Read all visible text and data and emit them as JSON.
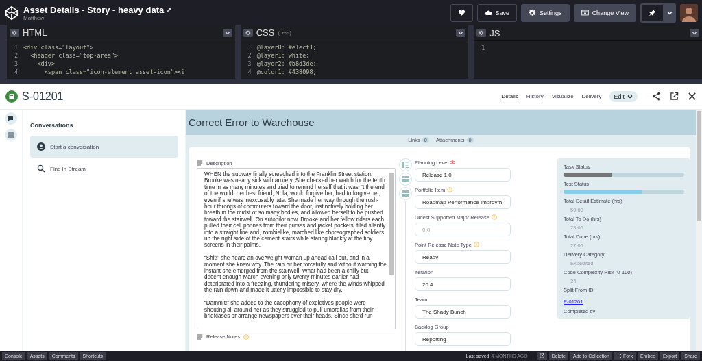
{
  "pen": {
    "title": "Asset Details - Story - heavy data",
    "author": "Matthew"
  },
  "toolbar": [
    {
      "kind": "heart"
    },
    {
      "kind": "save",
      "label": "Save"
    },
    {
      "kind": "settings",
      "label": "Settings"
    },
    {
      "kind": "view",
      "label": "Change View"
    },
    {
      "kind": "pin"
    }
  ],
  "editors": [
    {
      "title": "HTML",
      "lines": [
        {
          "number": "1",
          "code": "<div class=\"layout\">"
        },
        {
          "number": "2",
          "code": "  <header class=\"top-area\">"
        },
        {
          "number": "3",
          "code": "    <div>"
        },
        {
          "number": "4",
          "code": "      <span class=\"icon-element asset-icon\"><i"
        }
      ]
    },
    {
      "title": "CSS",
      "subtitle": "(Less)",
      "lines": [
        {
          "number": "1",
          "code": "@layer0: #e1ecf1;"
        },
        {
          "number": "2",
          "code": "@layer1: white;"
        },
        {
          "number": "3",
          "code": "@layer2: #b8d3de;"
        },
        {
          "number": "4",
          "code": "@color1: #438098;"
        }
      ]
    },
    {
      "title": "JS",
      "lines": [
        {
          "number": "1"
        }
      ]
    }
  ],
  "asset": {
    "id": "S-01201",
    "tabs": [
      {
        "label": "Details",
        "selected": true
      },
      {
        "label": "History",
        "selected": false
      },
      {
        "label": "Visualize",
        "selected": false
      },
      {
        "label": "Delivery",
        "selected": false
      }
    ],
    "edit": "Edit",
    "title": "Correct Error to Warehouse"
  },
  "conversations": {
    "heading": "Conversations",
    "items": [
      {
        "kind": "person",
        "label": "Start a conversation",
        "selected": true
      },
      {
        "kind": "search",
        "label": "Find in Stream",
        "selected": false
      }
    ]
  },
  "counts": [
    {
      "label": "Links",
      "count": "0"
    },
    {
      "label": "Attachments",
      "count": "0"
    }
  ],
  "description": {
    "label": "Description",
    "paragraphs": [
      "WHEN the subway finally screeched into the Franklin Street station, Brooke was nearly sick with anxiety. She checked her watch for the tenth time in as many minutes and tried to remind herself that it wasn't the end of the world; her best friend, Nola, would forgive her, had to forgive her, even if she was inexcusably late. She made her way through the rush-hour throngs of commuters toward the door, instinctively holding her breath in the midst of so many bodies, and allowed herself to be pushed toward the stairwell. On autopilot now, Brooke and her fellow riders each pulled their cell phones from their purses and jacket pockets, filed silently into a straight line and, zombielike, marched like choreographed soldiers up the right side of the cement stairs while staring blankly at the tiny screens in their palms.",
      "“Shit!” she heard an overweight woman up ahead call out, and in a moment she knew why. The rain hit her forcefully and without warning the instant she emerged from the stairwell. What had been a chilly but decent enough March evening only twenty minutes earlier had deteriorated into a freezing, thundering misery, where the winds whipped the rain down and made it utterly impossible to stay dry.",
      "“Dammit!” she added to the cacophony of expletives people were shouting all around her as they struggled to pull umbrellas from their briefcases or arrange newspapers over their heads. Since she'd run"
    ]
  },
  "release_notes": {
    "label": "Release Notes",
    "warning": true
  },
  "fields": [
    {
      "label": "Planning Level",
      "value": "Release 1.0",
      "required": true,
      "warning": false
    },
    {
      "label": "Portfolio Item",
      "value": "Roadmap Performance Improvm",
      "required": false,
      "warning": true
    },
    {
      "label": "Oldest Supported Major Release",
      "placeholder": "0.0",
      "required": false,
      "warning": true
    },
    {
      "label": "Point Release Note Type",
      "value": "Ready",
      "required": false,
      "warning": true
    },
    {
      "label": "Iteration",
      "value": "20.4",
      "required": false,
      "warning": false
    },
    {
      "label": "Team",
      "value": "The Shady Bunch",
      "required": false,
      "warning": false
    },
    {
      "label": "Backlog Group",
      "value": "Reporting",
      "required": false,
      "warning": false
    }
  ],
  "stats": [
    {
      "kind": "bar",
      "label": "Task Status",
      "level": 0.4,
      "color": "#757575"
    },
    {
      "kind": "bar",
      "label": "Test Status",
      "level": 0.65,
      "color": "#87cde9"
    },
    {
      "kind": "value",
      "label": "Total Detail Estimate (hrs)",
      "value": "50.00"
    },
    {
      "kind": "value",
      "label": "Total To Do (hrs)",
      "value": "23.00"
    },
    {
      "kind": "value",
      "label": "Total Done (hrs)",
      "value": "27.00"
    },
    {
      "kind": "value",
      "label": "Delivery Category",
      "value": "Expedited"
    },
    {
      "kind": "value",
      "label": "Code Complexity Risk (0-100)",
      "value": "34"
    },
    {
      "kind": "link",
      "label": "Split From ID",
      "value": "E-01201"
    },
    {
      "kind": "label",
      "label": "Completed by"
    }
  ],
  "footer": {
    "tabs": [
      "Console",
      "Assets",
      "Comments",
      "Shortcuts"
    ],
    "saved": "Last saved",
    "saved_when": "4 MONTHS AGO",
    "actions": [
      {
        "kind": "open"
      },
      {
        "kind": "text",
        "label": "Delete"
      },
      {
        "kind": "text",
        "label": "Add to Collection"
      },
      {
        "kind": "fork",
        "label": "Fork"
      },
      {
        "kind": "text",
        "label": "Embed"
      },
      {
        "kind": "text",
        "label": "Export"
      },
      {
        "kind": "text",
        "label": "Share"
      }
    ]
  }
}
